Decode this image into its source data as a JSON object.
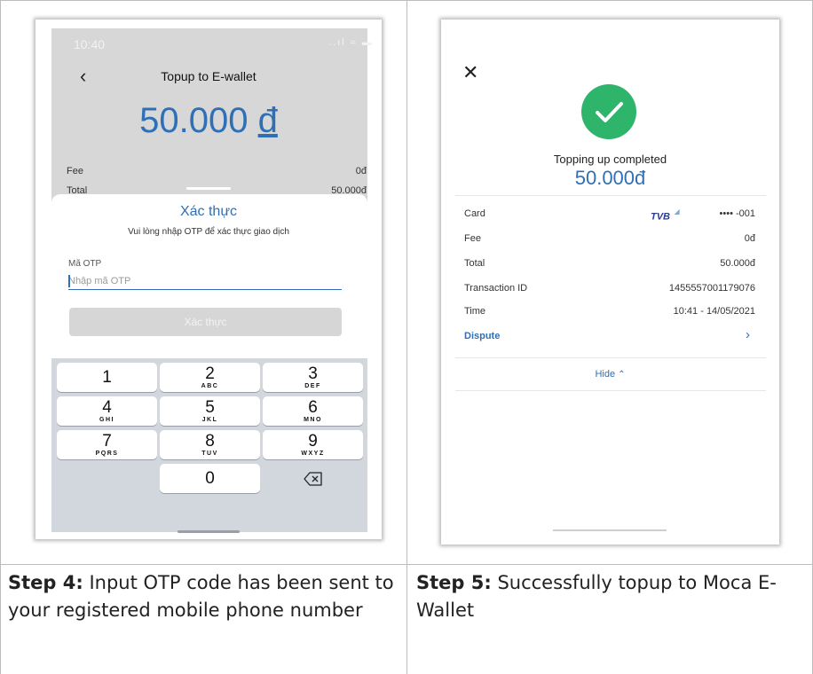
{
  "left_phone": {
    "status_time": "10:40",
    "status_icons": "..ıl ≈ ▬",
    "nav_title": "Topup to E-wallet",
    "amount": "50.000",
    "currency_symbol": "đ",
    "fee_label": "Fee",
    "fee_value": "0đ",
    "total_label": "Total",
    "total_value": "50.000đ",
    "sheet_title": "Xác thực",
    "sheet_subtitle": "Vui lòng nhập OTP để xác thực giao dịch",
    "otp_label": "Mã OTP",
    "otp_placeholder": "Nhập mã OTP",
    "verify_label": "Xác thực",
    "keypad": [
      {
        "digit": "1",
        "letters": ""
      },
      {
        "digit": "2",
        "letters": "ABC"
      },
      {
        "digit": "3",
        "letters": "DEF"
      },
      {
        "digit": "4",
        "letters": "GHI"
      },
      {
        "digit": "5",
        "letters": "JKL"
      },
      {
        "digit": "6",
        "letters": "MNO"
      },
      {
        "digit": "7",
        "letters": "PQRS"
      },
      {
        "digit": "8",
        "letters": "TUV"
      },
      {
        "digit": "9",
        "letters": "WXYZ"
      },
      {
        "digit": "0",
        "letters": ""
      }
    ]
  },
  "right_phone": {
    "completed_text": "Topping up completed",
    "amount": "50.000đ",
    "rows": [
      {
        "label": "Card",
        "value": "•••• -001"
      },
      {
        "label": "Fee",
        "value": "0đ"
      },
      {
        "label": "Total",
        "value": "50.000đ"
      },
      {
        "label": "Transaction ID",
        "value": "1455557001179076"
      },
      {
        "label": "Time",
        "value": "10:41 - 14/05/2021"
      }
    ],
    "card_bank": "TVB",
    "dispute_label": "Dispute",
    "hide_label": "Hide"
  },
  "captions": {
    "step4_label": "Step 4:",
    "step4_text": " Input OTP code has been sent to your registered mobile phone number",
    "step5_label": "Step 5:",
    "step5_text": " Successfully topup to Moca E-Wallet"
  },
  "colors": {
    "accent_blue": "#2f6fb6",
    "success_green": "#2fb56b",
    "keypad_bg": "#d2d6dd"
  }
}
